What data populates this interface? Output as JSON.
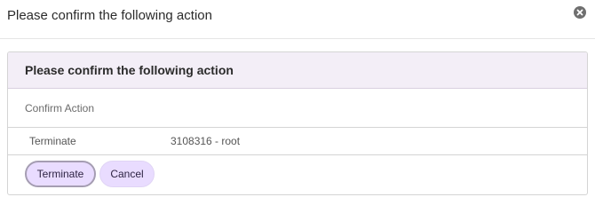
{
  "dialog": {
    "title": "Please confirm the following action",
    "close_icon": "close-icon"
  },
  "panel": {
    "heading": "Please confirm the following action",
    "section_label": "Confirm Action",
    "row": {
      "key": "Terminate",
      "value": "3108316 - root"
    }
  },
  "actions": {
    "terminate_label": "Terminate",
    "cancel_label": "Cancel"
  },
  "colors": {
    "panel_header_bg": "#f3eef7",
    "button_bg": "#e9dcff",
    "button_focus_border": "#a59db2"
  }
}
